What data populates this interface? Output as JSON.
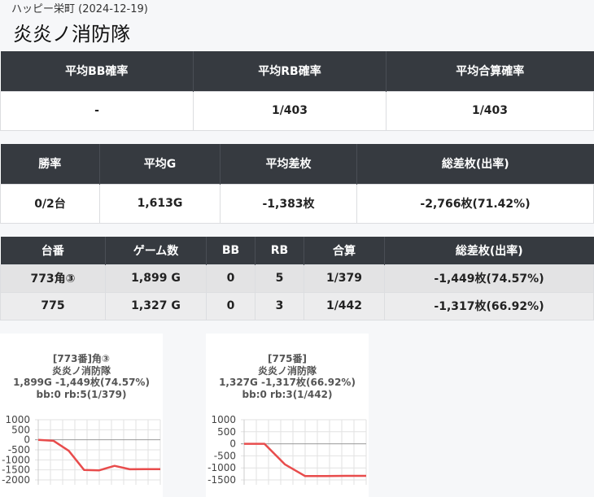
{
  "header": {
    "subtitle": "ハッピー栄町 (2024-12-19)",
    "title": "炎炎ノ消防隊"
  },
  "summary1": {
    "headers": [
      "平均BB確率",
      "平均RB確率",
      "平均合算確率"
    ],
    "values": [
      "-",
      "1/403",
      "1/403"
    ]
  },
  "summary2": {
    "headers": [
      "勝率",
      "平均G",
      "平均差枚",
      "総差枚(出率)"
    ],
    "values": [
      "0/2台",
      "1,613G",
      "-1,383枚",
      "-2,766枚(71.42%)"
    ]
  },
  "machines": {
    "headers": [
      "台番",
      "ゲーム数",
      "BB",
      "RB",
      "合算",
      "総差枚(出率)"
    ],
    "rows": [
      [
        "773角③",
        "1,899 G",
        "0",
        "5",
        "1/379",
        "-1,449枚(74.57%)"
      ],
      [
        "775",
        "1,327 G",
        "0",
        "3",
        "1/442",
        "-1,317枚(66.92%)"
      ]
    ]
  },
  "colors": {
    "header_bg": "#363a40",
    "line": "#e84c4c"
  },
  "chart_data": [
    {
      "type": "line",
      "title_lines": [
        "[773番]角③",
        "炎炎ノ消防隊",
        "1,899G -1,449枚(74.57%)",
        "bb:0 rb:5(1/379)"
      ],
      "ylim": [
        -2000,
        1000
      ],
      "yticks": [
        1000,
        500,
        0,
        -500,
        -1000,
        -1500,
        -2000
      ],
      "ytick_labels": [
        "1000",
        "500",
        "0",
        "-500",
        "-1000",
        "-1500",
        "-2000"
      ],
      "x": [
        0,
        1,
        2,
        3,
        4,
        5,
        6,
        7,
        8
      ],
      "values": [
        0,
        -50,
        -550,
        -1500,
        -1520,
        -1300,
        -1470,
        -1460,
        -1460
      ]
    },
    {
      "type": "line",
      "title_lines": [
        "[775番]",
        "炎炎ノ消防隊",
        "1,327G -1,317枚(66.92%)",
        "bb:0 rb:3(1/442)"
      ],
      "ylim": [
        -1500,
        1000
      ],
      "yticks": [
        1000,
        500,
        0,
        -500,
        -1000,
        -1500
      ],
      "ytick_labels": [
        "1000",
        "500",
        "0",
        "-500",
        "-1000",
        "-1500"
      ],
      "x": [
        0,
        1,
        2,
        3,
        4,
        5,
        6
      ],
      "values": [
        0,
        0,
        -850,
        -1340,
        -1340,
        -1330,
        -1330
      ]
    }
  ]
}
